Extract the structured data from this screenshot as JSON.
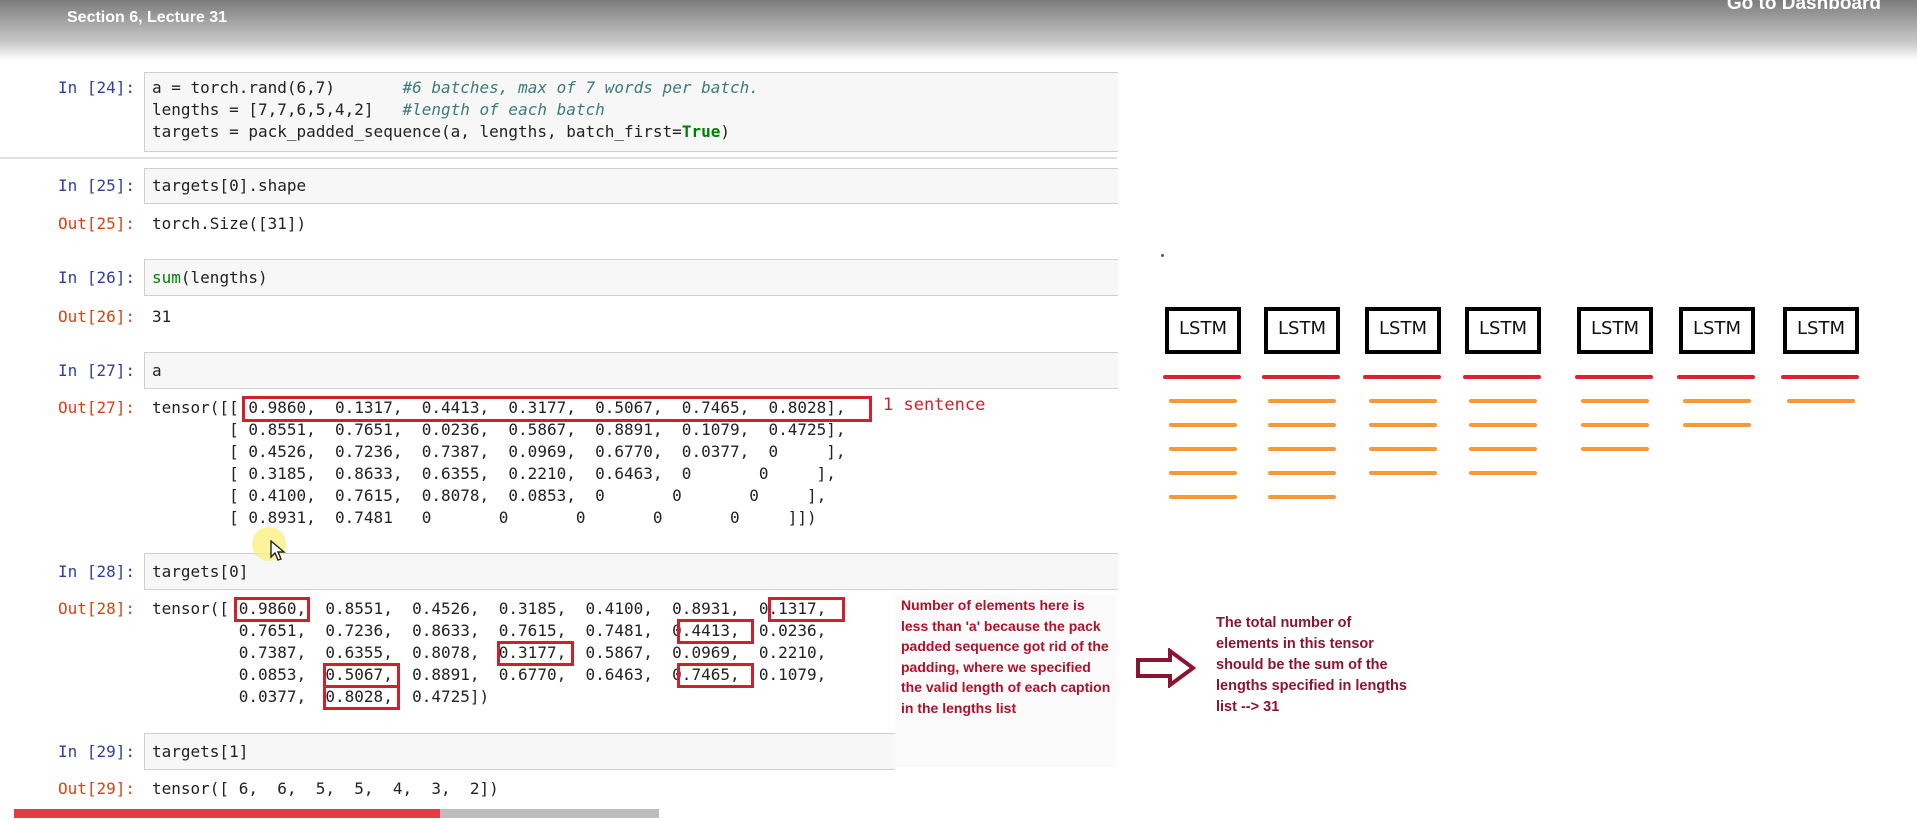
{
  "header": {
    "lecture_title": "Section 6, Lecture 31",
    "dashboard_link": "Go to Dashboard"
  },
  "cells": {
    "c24": {
      "prompt": "In [24]:",
      "line1_code": "a = torch.rand(6,7)",
      "line1_comment": "#6 batches, max of 7 words per batch.",
      "line2_code": "lengths = [7,7,6,5,4,2]",
      "line2_comment": "#length of each batch",
      "line3_pre": "targets = pack_padded_sequence(a, lengths, batch_first=",
      "line3_kw": "True",
      "line3_post": ")"
    },
    "c25": {
      "prompt": "In [25]:",
      "code": "targets[0].shape",
      "out_prompt": "Out[25]:",
      "output": "torch.Size([31])"
    },
    "c26": {
      "prompt": "In [26]:",
      "code_fn": "sum",
      "code_rest": "(lengths)",
      "out_prompt": "Out[26]:",
      "output": "31"
    },
    "c27": {
      "prompt": "In [27]:",
      "code": "a",
      "out_prompt": "Out[27]:",
      "rows": [
        "tensor([[ 0.9860,  0.1317,  0.4413,  0.3177,  0.5067,  0.7465,  0.8028],",
        "        [ 0.8551,  0.7651,  0.0236,  0.5867,  0.8891,  0.1079,  0.4725],",
        "        [ 0.4526,  0.7236,  0.7387,  0.0969,  0.6770,  0.0377,  0     ],",
        "        [ 0.3185,  0.8633,  0.6355,  0.2210,  0.6463,  0       0     ],",
        "        [ 0.4100,  0.7615,  0.8078,  0.0853,  0       0       0     ],",
        "        [ 0.8931,  0.7481   0       0       0       0       0     ]])"
      ]
    },
    "c28": {
      "prompt": "In [28]:",
      "code": "targets[0]",
      "out_prompt": "Out[28]:",
      "rows": [
        "tensor([ 0.9860,  0.8551,  0.4526,  0.3185,  0.4100,  0.8931,  0.1317,",
        "         0.7651,  0.7236,  0.8633,  0.7615,  0.7481,  0.4413,  0.0236,",
        "         0.7387,  0.6355,  0.8078,  0.3177,  0.5867,  0.0969,  0.2210,",
        "         0.0853,  0.5067,  0.8891,  0.6770,  0.6463,  0.7465,  0.1079,",
        "         0.0377,  0.8028,  0.4725])"
      ]
    },
    "c29": {
      "prompt": "In [29]:",
      "code": "targets[1]",
      "out_prompt": "Out[29]:",
      "output": "tensor([ 6,  6,  5,  5,  4,  3,  2])"
    }
  },
  "annotations": {
    "sentence_label": "1 sentence",
    "middle_note": "Number of elements here is less than 'a' because the pack padded sequence got rid of the padding, where we specified the valid length of each caption in the lengths list",
    "right_note": "The total number of elements in this tensor should be the sum of the lengths specified in lengths list --> 31"
  },
  "diagram": {
    "lstm_label": "LSTM",
    "columns": [
      {
        "label": "LSTM",
        "bar_count": 6
      },
      {
        "label": "LSTM",
        "bar_count": 6
      },
      {
        "label": "LSTM",
        "bar_count": 5
      },
      {
        "label": "LSTM",
        "bar_count": 5
      },
      {
        "label": "LSTM",
        "bar_count": 4
      },
      {
        "label": "LSTM",
        "bar_count": 3
      },
      {
        "label": "LSTM",
        "bar_count": 2
      }
    ],
    "colors": {
      "first_bar": "#e02030",
      "other_bars": "#f59a3c",
      "box_border": "#000000"
    }
  },
  "progress": {
    "fraction": 0.66
  }
}
